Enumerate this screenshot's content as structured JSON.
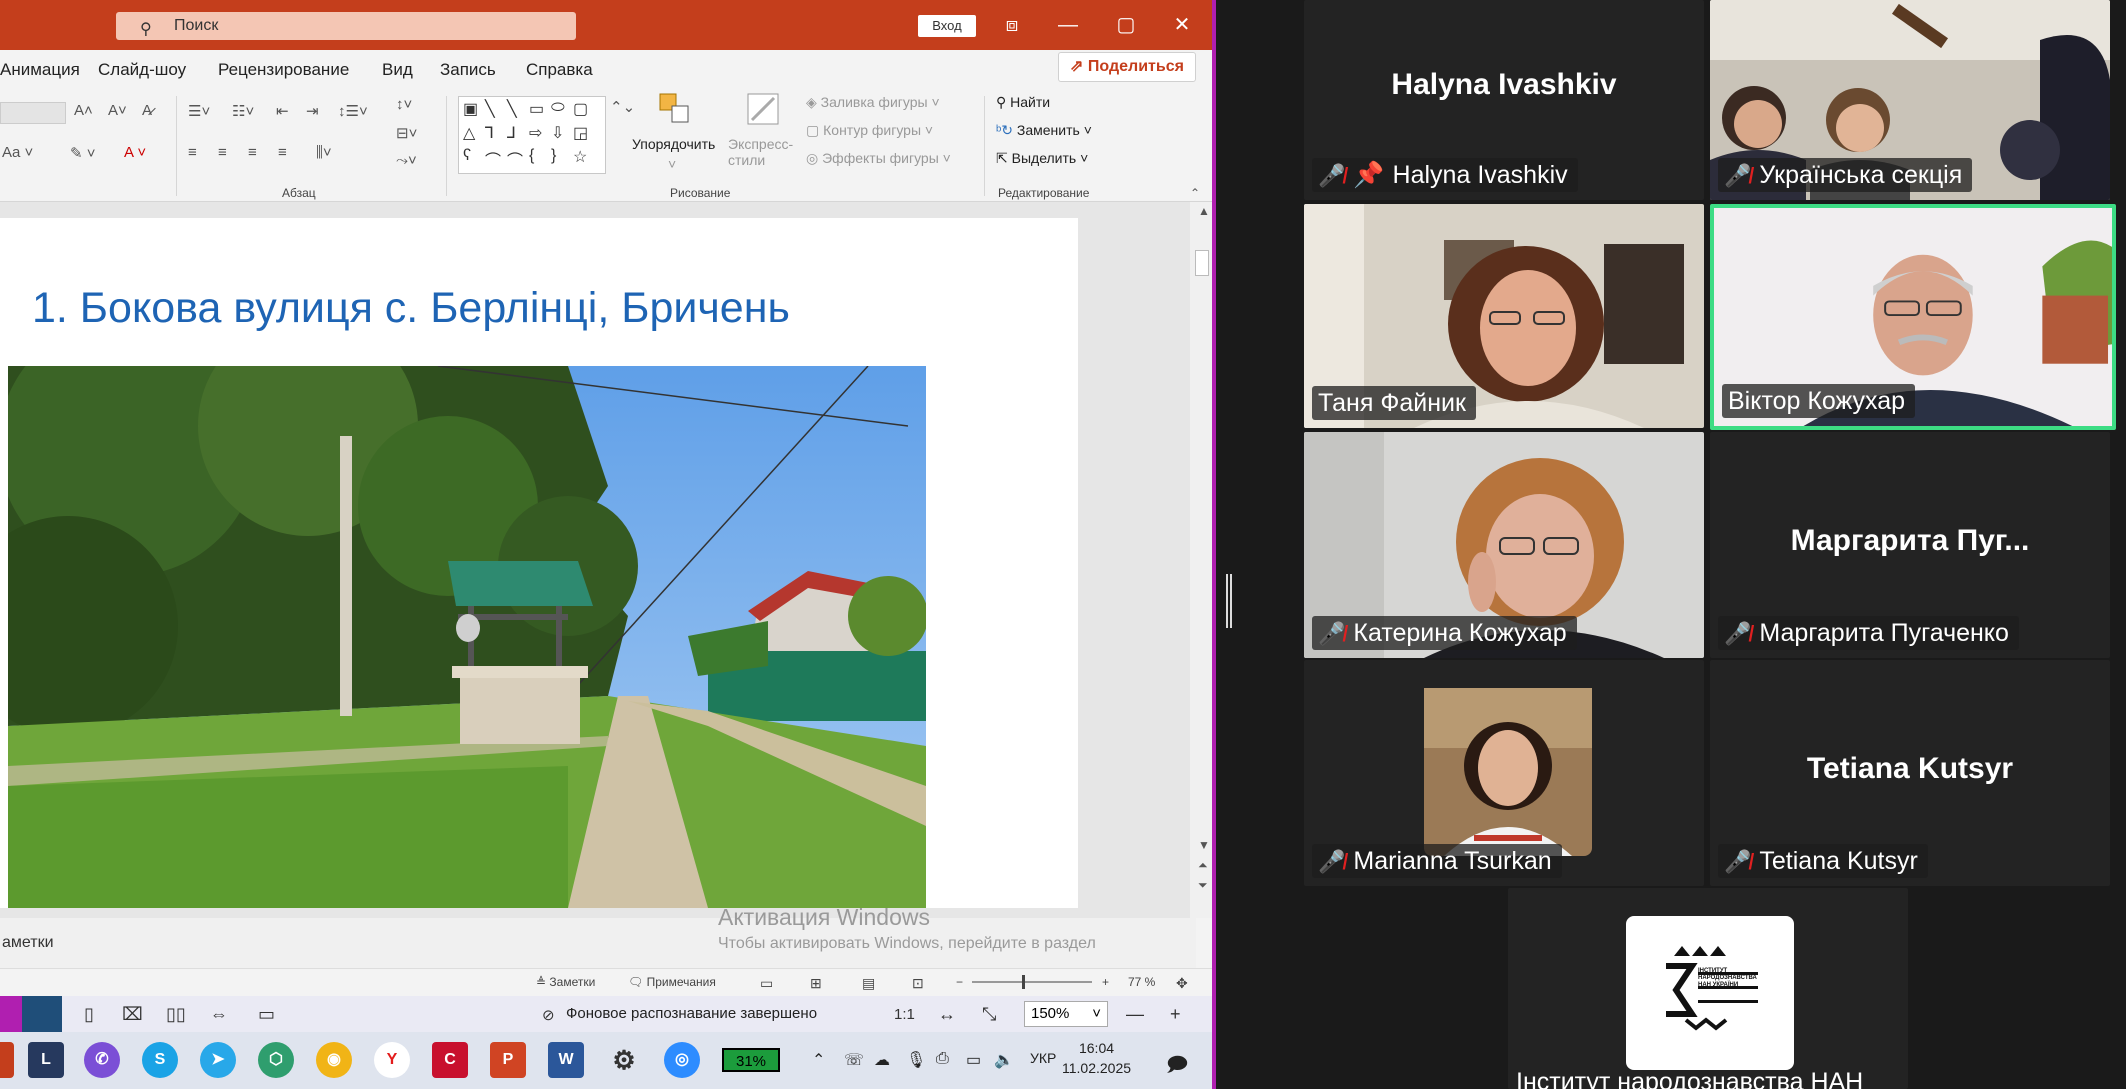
{
  "ppt": {
    "search_placeholder": "Поиск",
    "signin": "Вход",
    "share": "Поделиться",
    "menu": [
      "Анимация",
      "Слайд-шоу",
      "Рецензирование",
      "Вид",
      "Запись",
      "Справка"
    ],
    "ribbon": {
      "group_paragraph": "Абзац",
      "group_drawing": "Рисование",
      "group_editing": "Редактирование",
      "arrange": "Упорядочить",
      "quick_styles": "Экспресс-стили",
      "shape_fill": "Заливка фигуры",
      "shape_outline": "Контур фигуры",
      "shape_effects": "Эффекты фигуры",
      "find": "Найти",
      "replace": "Заменить",
      "select": "Выделить"
    },
    "slide_title": "1. Бокова вулиця с. Берлінці, Бричень",
    "notes_label": "аметки",
    "activation_title": "Активация Windows",
    "activation_sub": "Чтобы активировать Windows, перейдите в раздел",
    "status": {
      "notes": "Заметки",
      "comments": "Примечания",
      "zoom": "77 %"
    }
  },
  "viewer": {
    "ocr_status": "Фоновое распознавание завершено",
    "ratio": "1:1",
    "zoom": "150%"
  },
  "taskbar": {
    "battery": "31%",
    "lang": "УКР",
    "time": "16:04",
    "date": "11.02.2025"
  },
  "participants": [
    {
      "display": "Halyna Ivashkiv",
      "label": "Halyna Ivashkiv",
      "muted": true,
      "pinned": true
    },
    {
      "display": "",
      "label": "Українська секція",
      "muted": true
    },
    {
      "display": "",
      "label": "Таня Файник",
      "muted": false
    },
    {
      "display": "",
      "label": "Віктор Кожухар",
      "muted": false,
      "active": true
    },
    {
      "display": "",
      "label": "Катерина Кожухар",
      "muted": true
    },
    {
      "display": "Маргарита  Пуг...",
      "label": "Маргарита Пугаченко",
      "muted": true
    },
    {
      "display": "",
      "label": "Marianna Tsurkan",
      "muted": true
    },
    {
      "display": "Tetiana Kutsyr",
      "label": "Tetiana Kutsyr",
      "muted": true
    },
    {
      "display": "",
      "label": "Інститут народознавства НАН",
      "muted": false
    }
  ],
  "logo_text": "ІНСТИТУТ НАРОДОЗНАВСТВА НАН УКРАЇНИ",
  "colors": {
    "ppt_accent": "#c43e1c",
    "active_speaker": "#3ddc84",
    "title_blue": "#1e64b4"
  }
}
